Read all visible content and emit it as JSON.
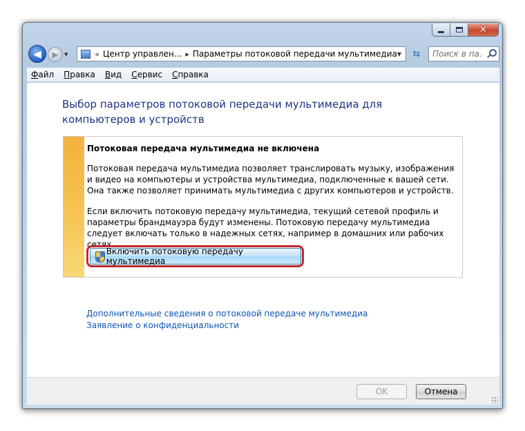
{
  "window": {
    "caption_buttons": {
      "minimize_icon": "minimize-icon",
      "maximize_icon": "maximize-icon",
      "close_glyph": "✕"
    }
  },
  "nav": {
    "back_glyph": "◀",
    "forward_glyph": "▶",
    "breadcrumbs": [
      "Центр управлен...",
      "Параметры потоковой передачи мультимедиа"
    ],
    "crumb_separator": "▸",
    "crumb_prefix": "«",
    "refresh_glyph": "⇆",
    "search_placeholder": "Поиск в па..."
  },
  "menu": {
    "items": [
      {
        "hotkey": "Ф",
        "rest": "айл"
      },
      {
        "hotkey": "П",
        "rest": "равка"
      },
      {
        "hotkey": "В",
        "rest": "ид"
      },
      {
        "hotkey": "С",
        "rest": "ервис"
      },
      {
        "hotkey": "С",
        "rest": "правка"
      }
    ]
  },
  "main": {
    "title": "Выбор параметров потоковой передачи мультимедиа для компьютеров и устройств",
    "infobox": {
      "heading": "Потоковая передача мультимедиа не включена",
      "paragraph1": "Потоковая передача мультимедиа позволяет транслировать музыку, изображения и видео на компьютеры и устройства мультимедиа, подключенные к вашей сети. Она также позволяет принимать мультимедиа с других компьютеров и устройств.",
      "paragraph2": "Если включить потоковую передачу мультимедиа, текущий сетевой профиль и параметры брандмауэра будут изменены. Потоковую передачу мультимедиа следует включать только в надежных сетях, например в домашних или рабочих сетях.",
      "enable_button": "Включить потоковую передачу мультимедиа"
    },
    "links": [
      "Дополнительные сведения о потоковой передаче мультимедиа",
      "Заявление о конфиденциальности"
    ]
  },
  "footer": {
    "ok_label": "OK",
    "cancel_label": "Отмена"
  },
  "colors": {
    "title_blue": "#1e3287",
    "link_blue": "#0b53b5",
    "stripe_yellow": "#f6c24f",
    "highlight_red": "#c1272d"
  }
}
